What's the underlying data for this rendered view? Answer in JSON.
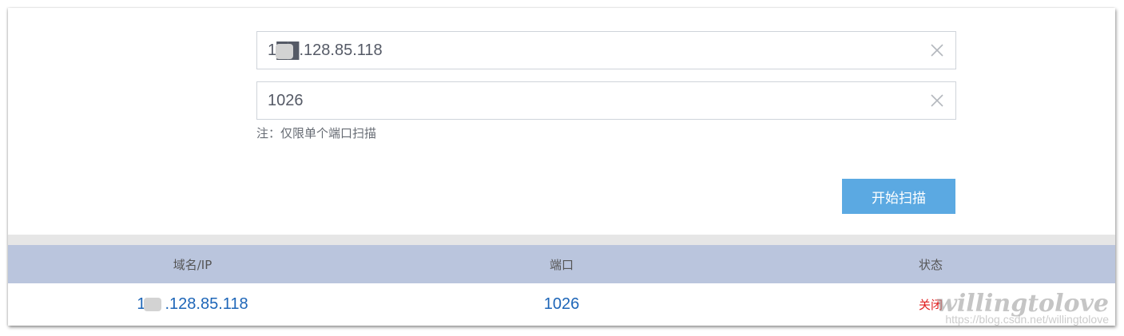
{
  "form": {
    "host_value": "1██.128.85.118",
    "port_value": "1026",
    "note": "注：仅限单个端口扫描",
    "scan_button": "开始扫描",
    "clear_icon": "close-icon"
  },
  "table": {
    "headers": [
      "域名/IP",
      "端口",
      "状态"
    ],
    "rows": [
      {
        "ip_prefix": "1",
        "ip_rest": ".128.85.118",
        "port": "1026",
        "status": "关闭"
      }
    ]
  },
  "watermark": {
    "title": "willingtolove",
    "url": "https://blog.csdn.net/willingtolove"
  },
  "colors": {
    "accent_button": "#5ba9e2",
    "header_bg": "#bac5dd",
    "link_blue": "#1e66b8",
    "status_closed": "#e02020"
  }
}
